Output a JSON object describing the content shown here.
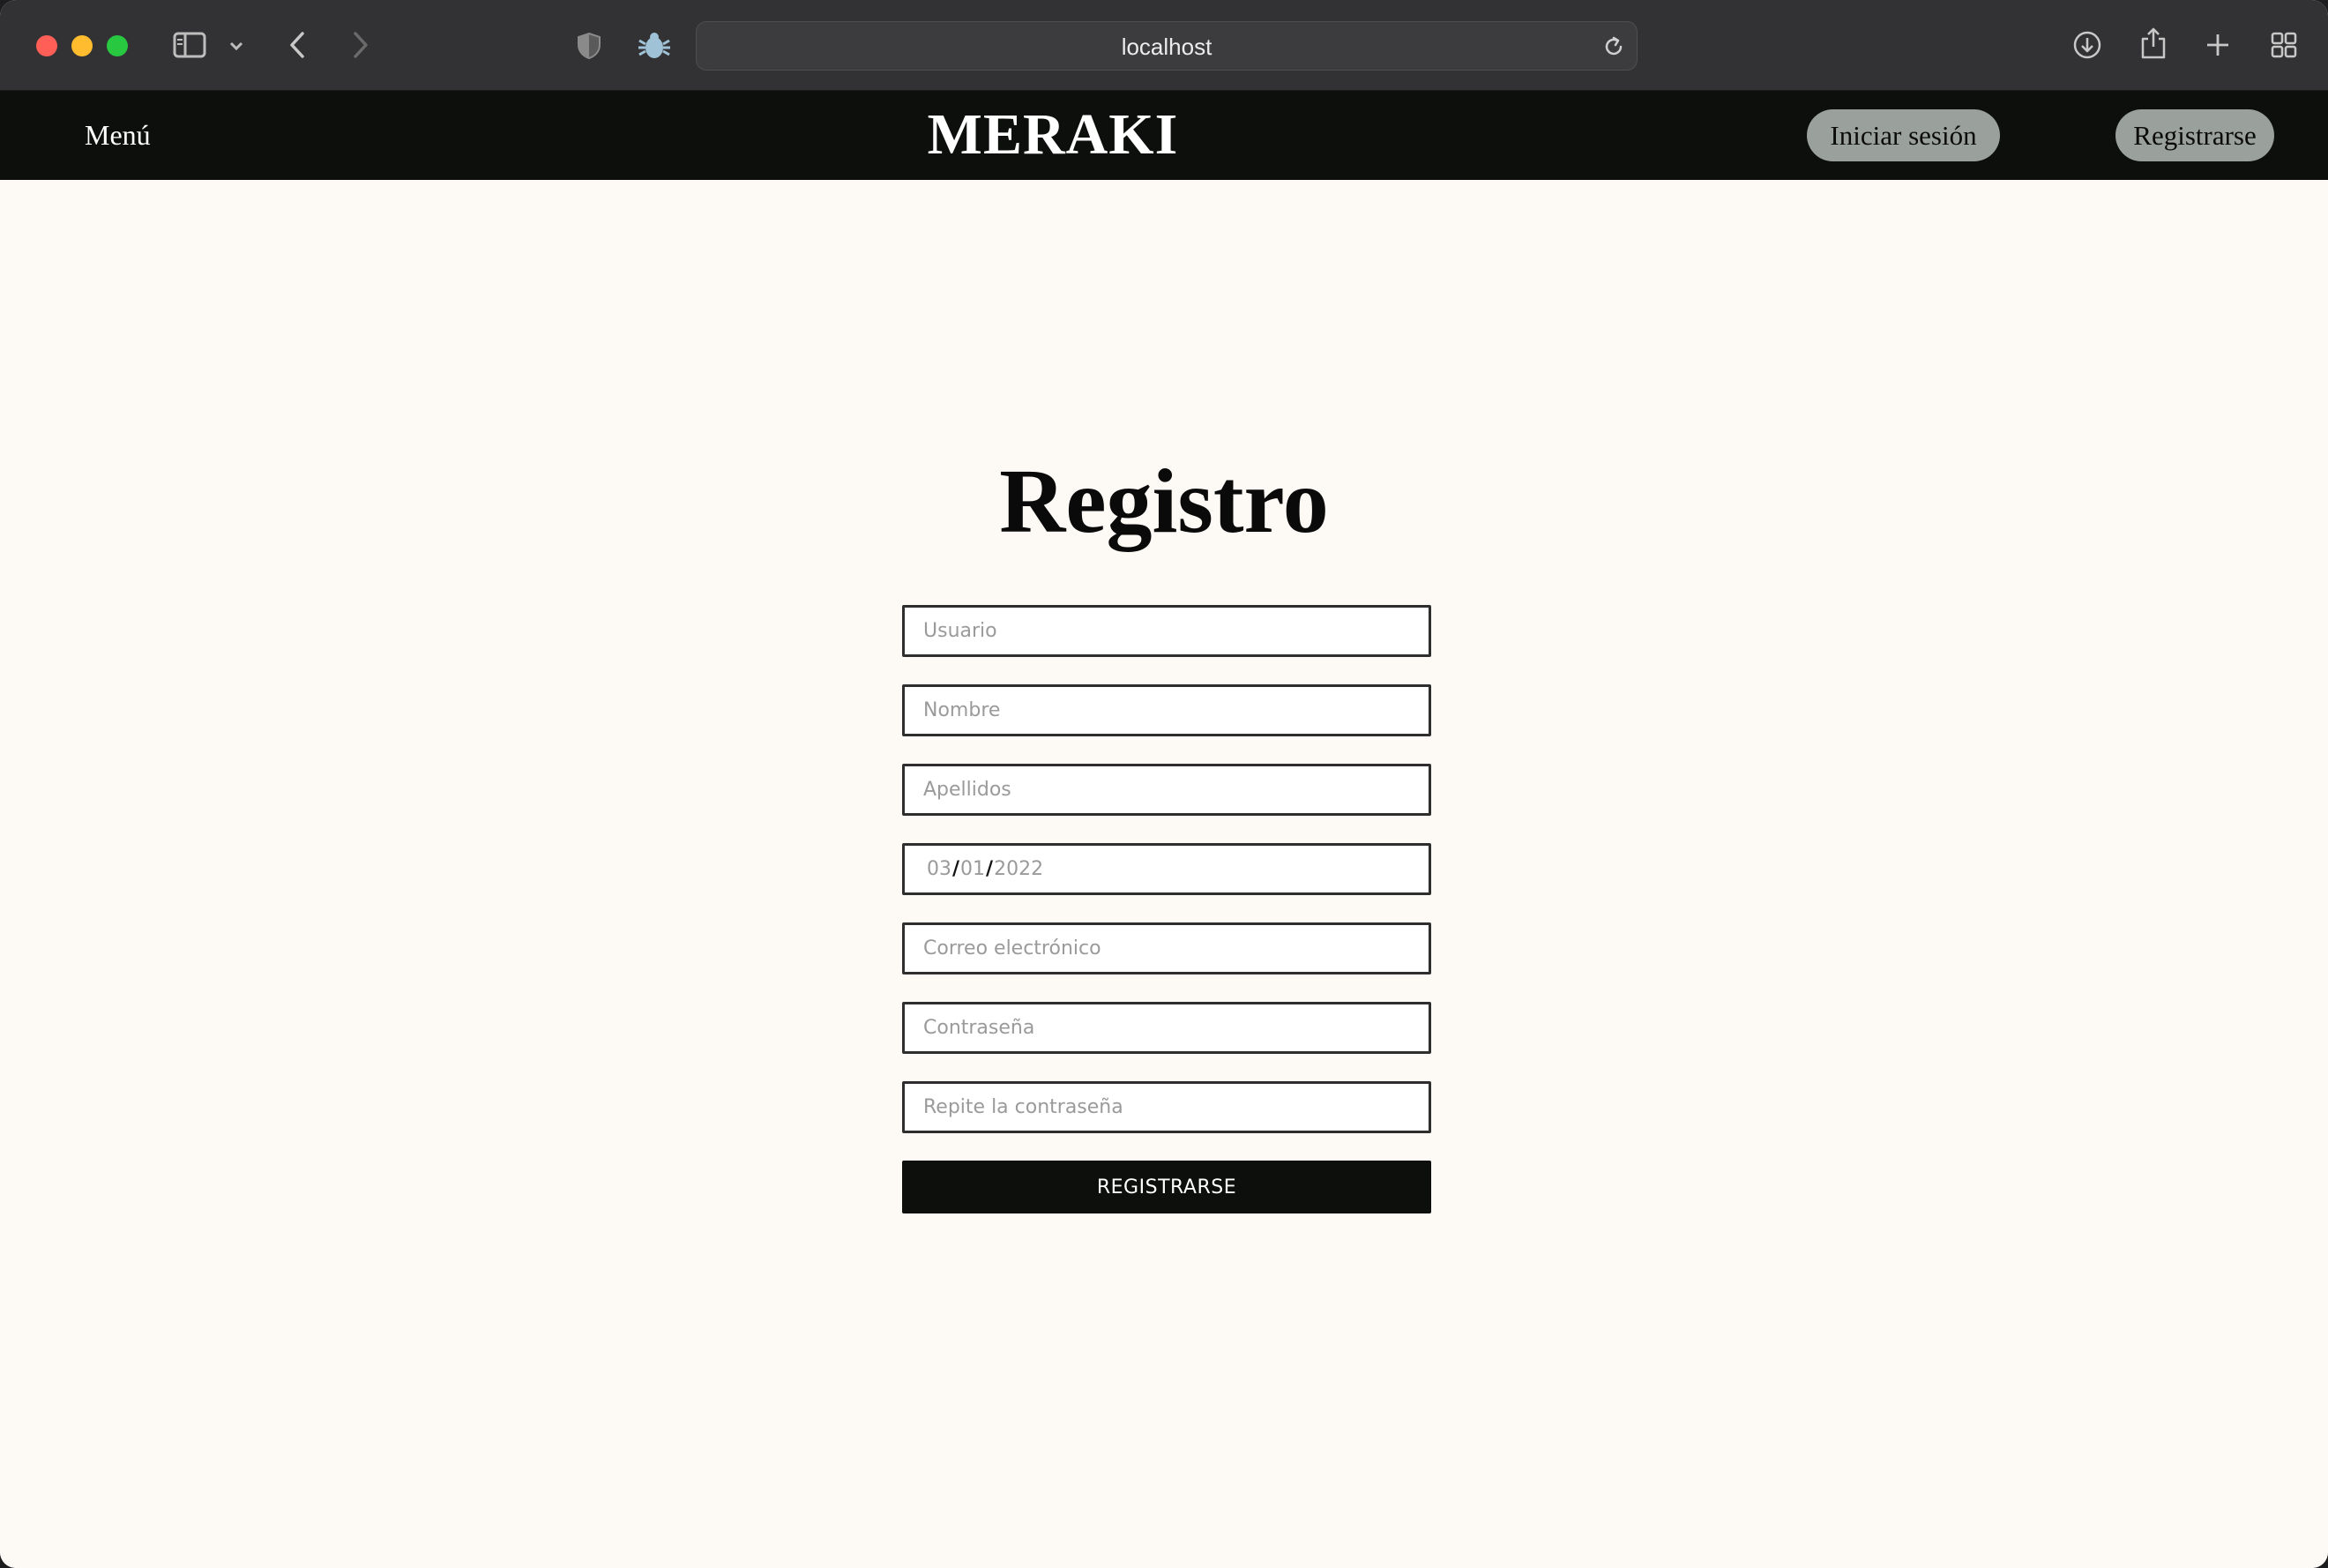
{
  "browser": {
    "address": "localhost",
    "icons": [
      "sidebar-icon",
      "chevron-down-icon",
      "back-icon",
      "forward-icon",
      "shield-icon",
      "bug-icon",
      "reload-icon",
      "download-icon",
      "share-icon",
      "plus-icon",
      "tab-overview-icon"
    ]
  },
  "header": {
    "menu_label": "Menú",
    "brand": "MERAKI",
    "login_label": "Iniciar sesión",
    "register_label": "Registrarse"
  },
  "form": {
    "title": "Registro",
    "username_placeholder": "Usuario",
    "name_placeholder": "Nombre",
    "surname_placeholder": "Apellidos",
    "birthdate": {
      "month": "03",
      "day": "01",
      "year": "2022",
      "separator": "/"
    },
    "email_placeholder": "Correo electrónico",
    "password_placeholder": "Contraseña",
    "repeat_password_placeholder": "Repite la contraseña",
    "submit_label": "REGISTRARSE"
  },
  "colors": {
    "header_bg": "#0d0f0d",
    "page_bg": "#fdfaf6",
    "pill_bg": "#9aa09b",
    "button_bg": "#0d0f0d"
  }
}
